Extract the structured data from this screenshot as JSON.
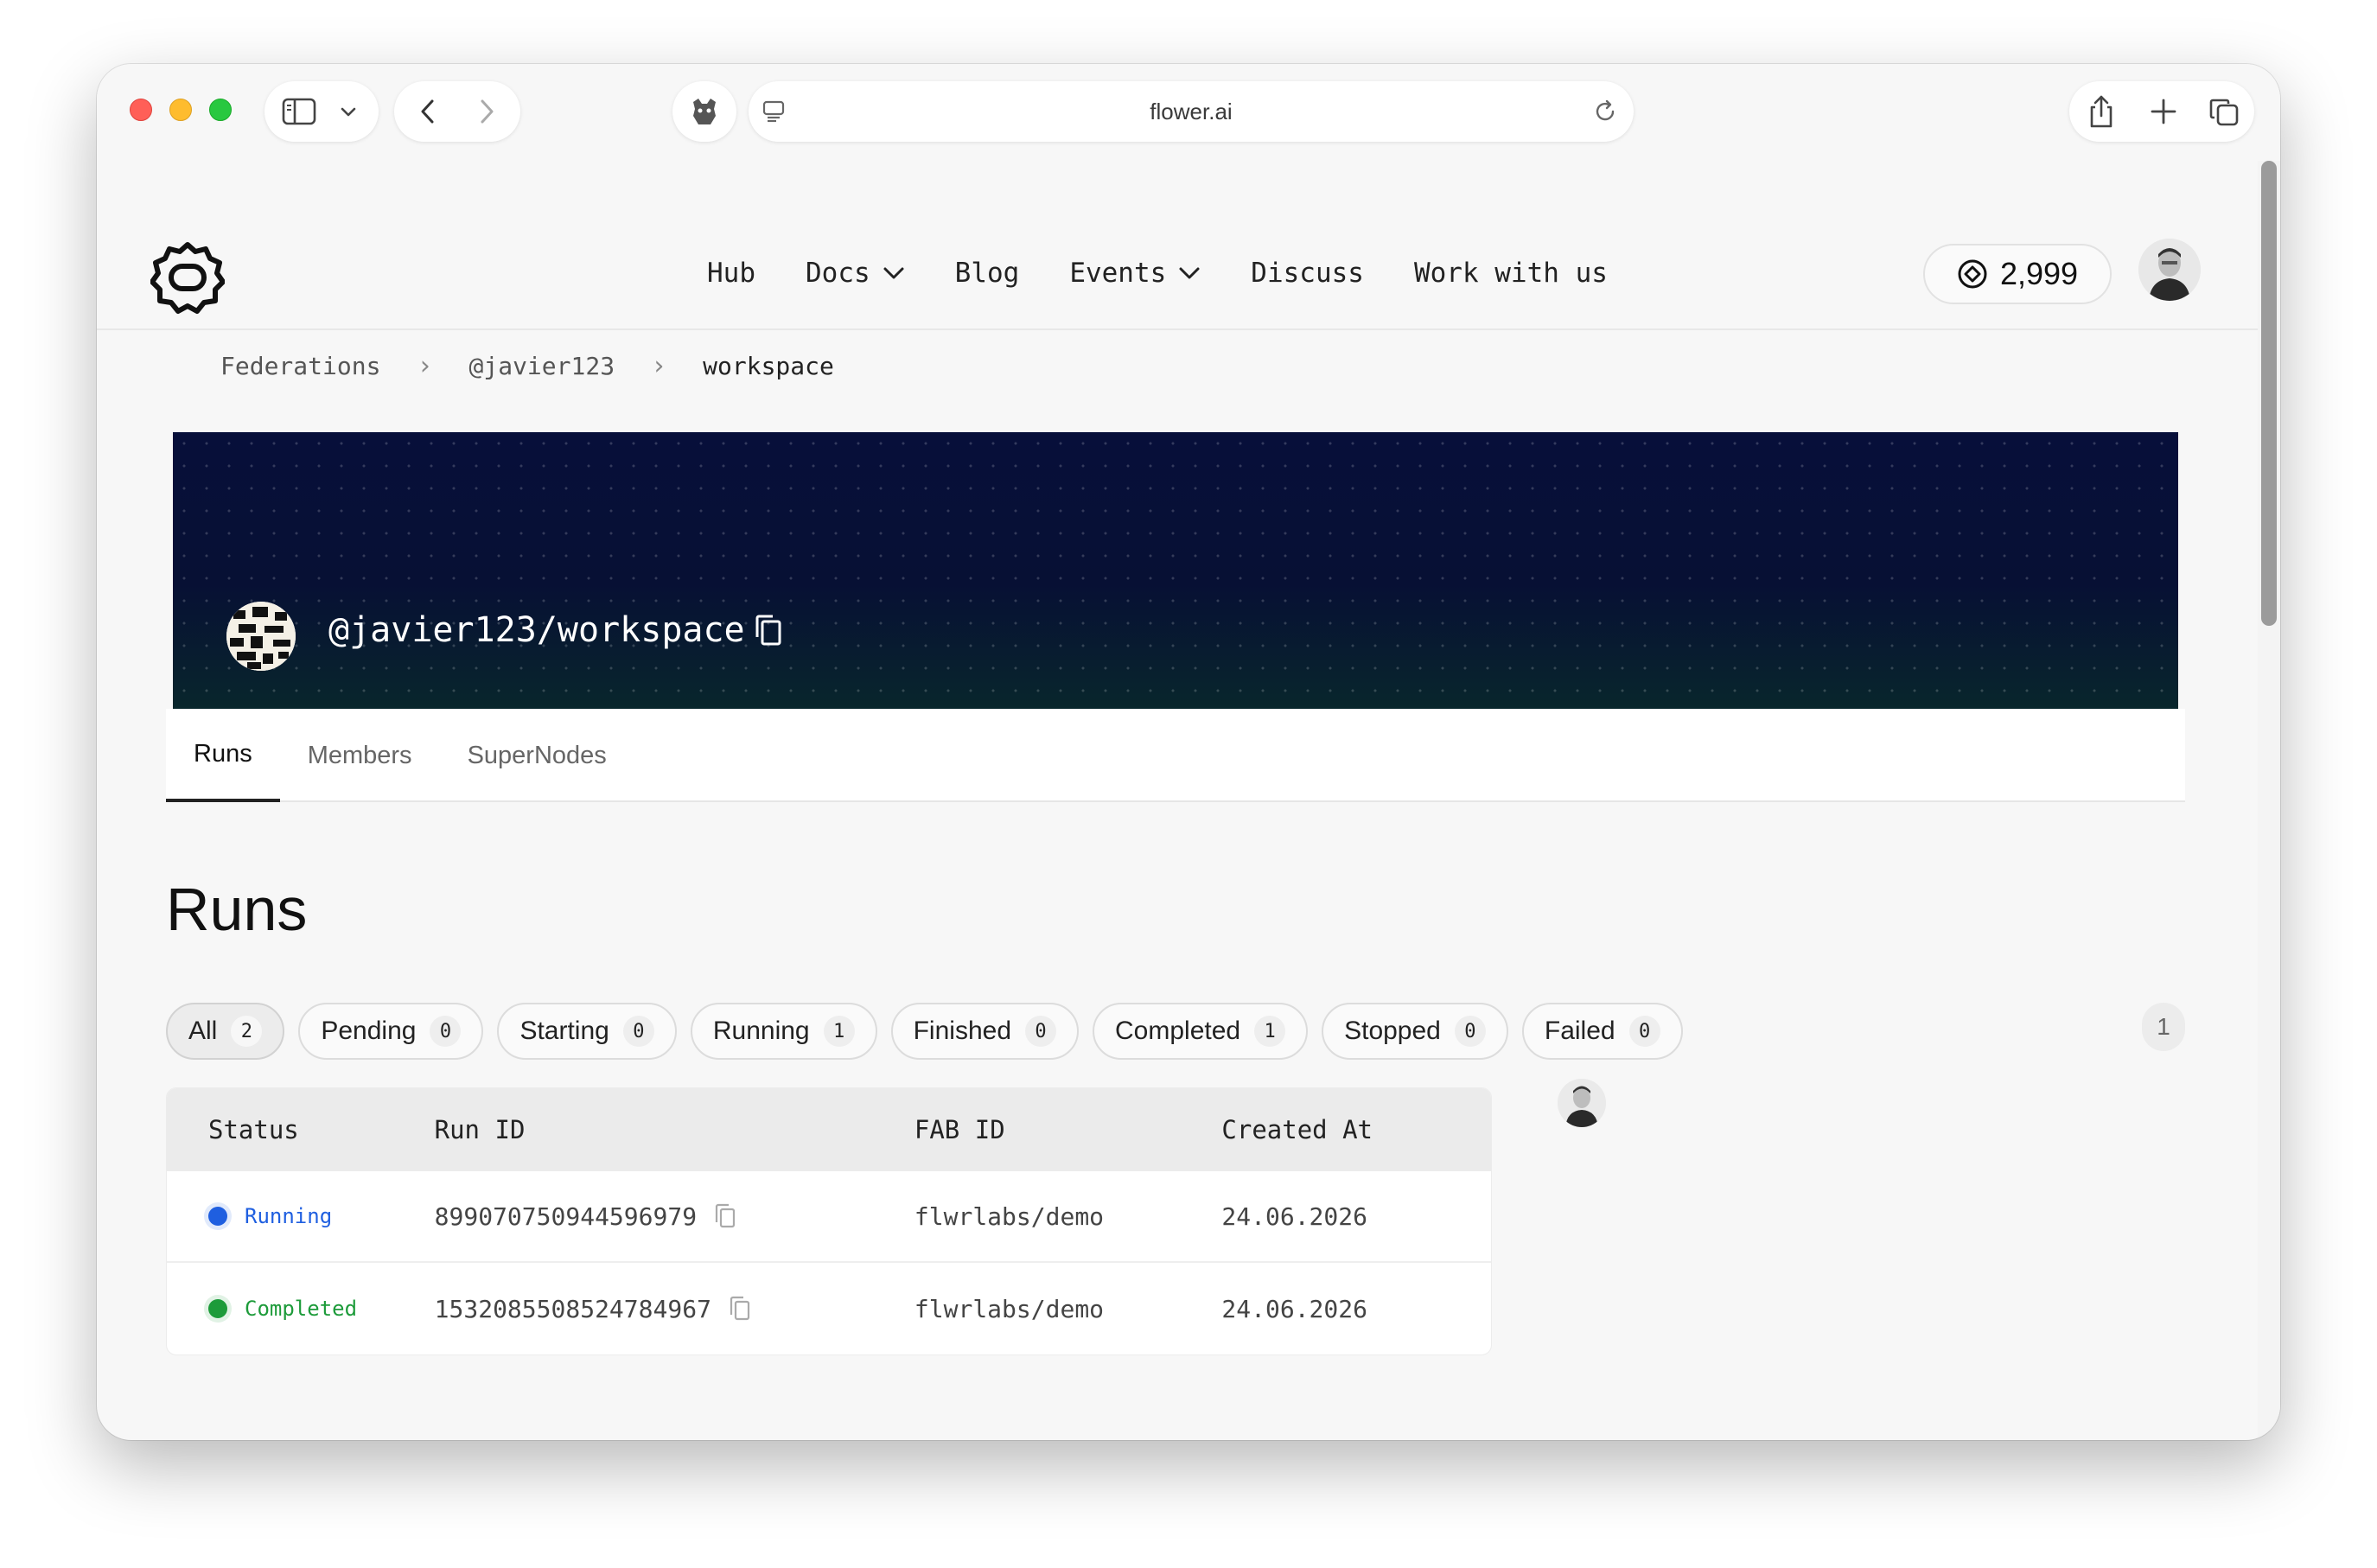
{
  "browser": {
    "url": "flower.ai"
  },
  "header": {
    "nav": [
      {
        "label": "Hub",
        "has_dropdown": false
      },
      {
        "label": "Docs",
        "has_dropdown": true
      },
      {
        "label": "Blog",
        "has_dropdown": false
      },
      {
        "label": "Events",
        "has_dropdown": true
      },
      {
        "label": "Discuss",
        "has_dropdown": false
      },
      {
        "label": "Work with us",
        "has_dropdown": false
      }
    ],
    "credits": "2,999"
  },
  "breadcrumb": [
    "Federations",
    "@javier123",
    "workspace"
  ],
  "banner": {
    "title": "@javier123/workspace"
  },
  "tabs": [
    "Runs",
    "Members",
    "SuperNodes"
  ],
  "page_title": "Runs",
  "filters": [
    {
      "label": "All",
      "count": "2"
    },
    {
      "label": "Pending",
      "count": "0"
    },
    {
      "label": "Starting",
      "count": "0"
    },
    {
      "label": "Running",
      "count": "1"
    },
    {
      "label": "Finished",
      "count": "0"
    },
    {
      "label": "Completed",
      "count": "1"
    },
    {
      "label": "Stopped",
      "count": "0"
    },
    {
      "label": "Failed",
      "count": "0"
    }
  ],
  "pagination": {
    "current": "1"
  },
  "table": {
    "headers": [
      "Status",
      "Run ID",
      "FAB ID",
      "Created At"
    ],
    "rows": [
      {
        "status": "Running",
        "status_color": "#1f5fe0",
        "run_id": "899070750944596979",
        "fab_id": "flwrlabs/demo",
        "created_at": "24.06.2026"
      },
      {
        "status": "Completed",
        "status_color": "#1d9b3a",
        "run_id": "1532085508524784967",
        "fab_id": "flwrlabs/demo",
        "created_at": "24.06.2026"
      }
    ]
  },
  "icons": [
    "sidebar-icon",
    "chevron-down-icon",
    "back-icon",
    "forward-icon",
    "extension-icon",
    "reader-icon",
    "reload-icon",
    "share-icon",
    "new-tab-icon",
    "tabs-icon",
    "flower-logo-icon",
    "credits-icon",
    "copy-icon"
  ]
}
